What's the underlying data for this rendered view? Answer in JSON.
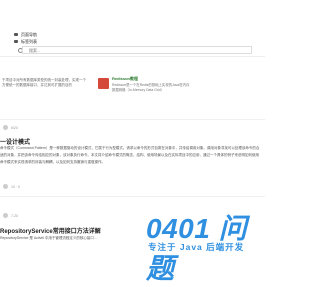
{
  "nav": {
    "items": [
      {
        "icon": "folder-icon",
        "label": "页面导航"
      },
      {
        "icon": "folder-icon",
        "label": "标签列表"
      }
    ]
  },
  "search": {
    "placeholder": "搜索..."
  },
  "card_left": {
    "text": "于项目中对所有数据库类型的统一封装处理，实现一个方便统一的数据库接口，并达到可扩展的目的"
  },
  "card_right": {
    "title": "Redisson教程",
    "desc": "Redisson是一个在Redis的基础上实现的Java驻内存数据网格（In-Memory Data Grid）"
  },
  "article1": {
    "meta": "6/20",
    "title": "一设计模式",
    "body": "命令模式（Command Pattern）是一种数据驱动的设计模式，它属于行为型模式。请求以命令的形式包裹在对象中，并传给调用对象。调用对象寻找可以处理该命令的合适的对象，并把该命令传给相应的对象，该对象执行命令。本文将介绍命令模式的概念、结构、使用场景以及在实际项目中的应用，通过一个具体的例子来说明如何使用命令模式来实现请求的封装与解耦，以及如何支持撤销与重做操作。",
    "footer": "10 · 0"
  },
  "article2": {
    "meta": "7-20",
    "title": "RepositoryService常用接口方法详解",
    "body": "RepositoryService 是 Activiti 中用于管理流程定义的核心接口..."
  },
  "watermark": {
    "main": "0401 问题",
    "sub": "专注于 Java 后端开发"
  }
}
